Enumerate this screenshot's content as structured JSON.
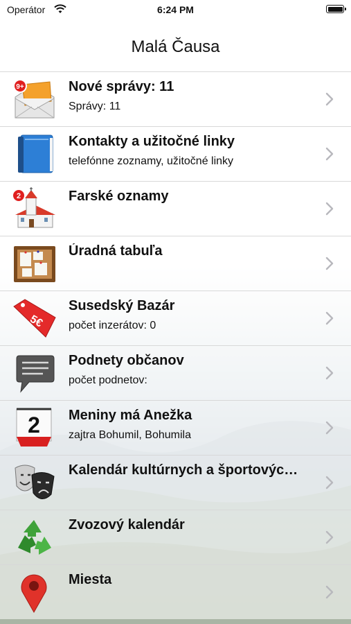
{
  "status_bar": {
    "carrier": "Operátor",
    "time": "6:24 PM"
  },
  "nav": {
    "title": "Malá Čausa"
  },
  "items": [
    {
      "icon": "mail-envelope-icon",
      "badge": "9+",
      "title": "Nové správy: 11",
      "subtitle": "Správy: 11"
    },
    {
      "icon": "address-book-icon",
      "title": "Kontakty a užitočné linky",
      "subtitle": "telefónne zoznamy, užitočné linky"
    },
    {
      "icon": "church-icon",
      "badge": "2",
      "title": "Farské oznamy",
      "subtitle": ""
    },
    {
      "icon": "bulletin-board-icon",
      "title": "Úradná tabuľa",
      "subtitle": ""
    },
    {
      "icon": "price-tag-icon",
      "tag_text": "5€",
      "title": "Susedský Bazár",
      "subtitle": "počet inzerátov: 0"
    },
    {
      "icon": "speech-bubble-icon",
      "title": "Podnety občanov",
      "subtitle": "počet podnetov:"
    },
    {
      "icon": "calendar-icon",
      "calendar_day": "2",
      "title": "Meniny má Anežka",
      "subtitle": "zajtra Bohumil, Bohumila"
    },
    {
      "icon": "theater-masks-icon",
      "title": "Kalendár kultúrnych a športovýc…",
      "subtitle": ""
    },
    {
      "icon": "recycle-icon",
      "title": "Zvozový kalendár",
      "subtitle": ""
    },
    {
      "icon": "map-pin-icon",
      "title": "Miesta",
      "subtitle": ""
    }
  ]
}
